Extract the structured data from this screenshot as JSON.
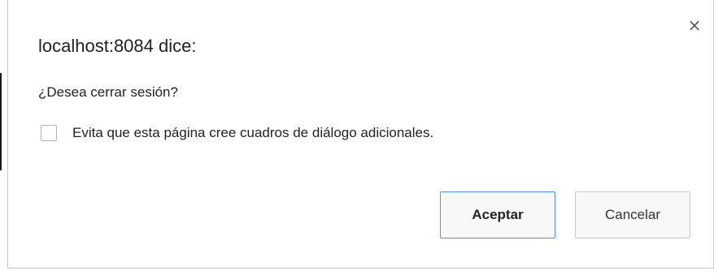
{
  "dialog": {
    "title": "localhost:8084 dice:",
    "message": "¿Desea cerrar sesión?",
    "checkbox_label": "Evita que esta página cree cuadros de diálogo adicionales.",
    "checkbox_checked": false,
    "close_glyph": "×",
    "close_icon": "close-icon",
    "accept_label": "Aceptar",
    "cancel_label": "Cancelar",
    "focus_color": "#4d90fe"
  }
}
